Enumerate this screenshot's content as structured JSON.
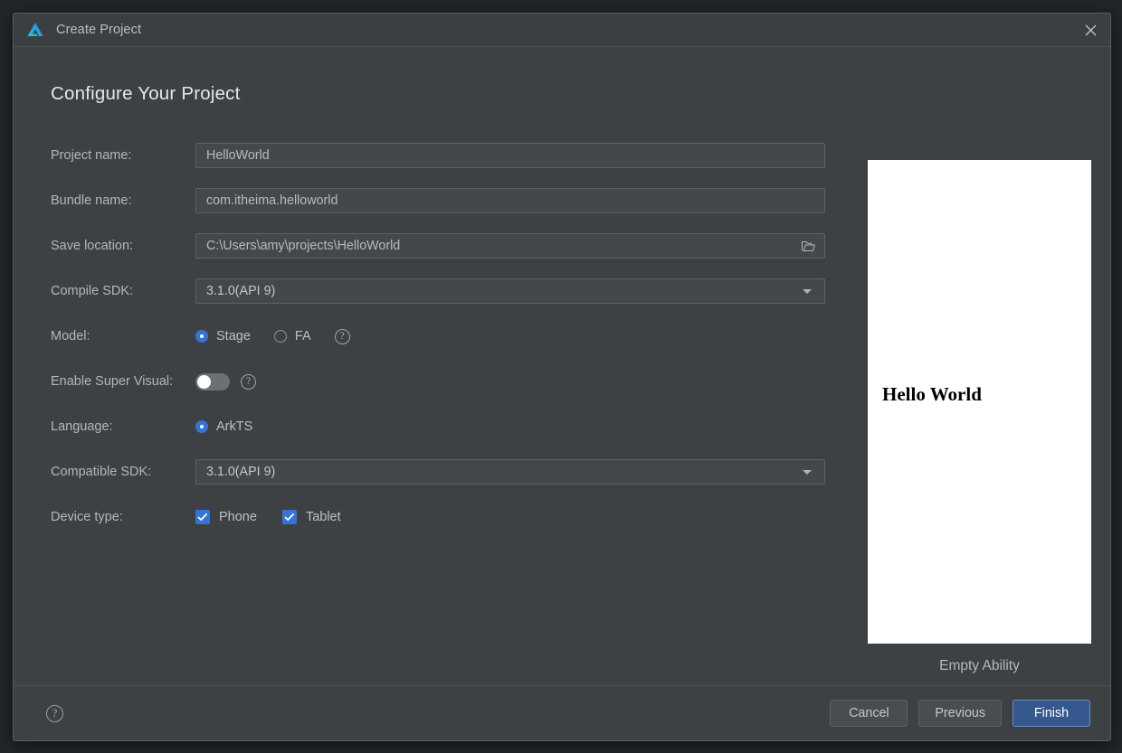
{
  "window": {
    "title": "Create Project",
    "logo_icon": "devtools-logo-icon",
    "close_icon": "close-icon"
  },
  "main": {
    "heading": "Configure Your Project",
    "fields": {
      "project_name": {
        "label": "Project name:",
        "value": "HelloWorld"
      },
      "bundle_name": {
        "label": "Bundle name:",
        "value": "com.itheima.helloworld"
      },
      "save_location": {
        "label": "Save location:",
        "value": "C:\\Users\\amy\\projects\\HelloWorld",
        "icon": "folder-open-icon"
      },
      "compile_sdk": {
        "label": "Compile SDK:",
        "value": "3.1.0(API 9)",
        "icon": "chevron-down-icon"
      },
      "model": {
        "label": "Model:",
        "options": [
          {
            "label": "Stage",
            "selected": true
          },
          {
            "label": "FA",
            "selected": false
          }
        ],
        "help_icon": "help-icon",
        "help_glyph": "?"
      },
      "enable_super_visual": {
        "label": "Enable Super Visual:",
        "state": "off",
        "help_icon": "help-icon",
        "help_glyph": "?"
      },
      "language": {
        "label": "Language:",
        "options": [
          {
            "label": "ArkTS",
            "selected": true
          }
        ]
      },
      "compatible_sdk": {
        "label": "Compatible SDK:",
        "value": "3.1.0(API 9)",
        "icon": "chevron-down-icon"
      },
      "device_type": {
        "label": "Device type:",
        "options": [
          {
            "label": "Phone",
            "checked": true
          },
          {
            "label": "Tablet",
            "checked": true
          }
        ]
      }
    }
  },
  "preview": {
    "screen_text": "Hello World",
    "caption": "Empty Ability"
  },
  "footer": {
    "help_glyph": "?",
    "help_icon": "help-icon",
    "cancel_label": "Cancel",
    "previous_label": "Previous",
    "finish_label": "Finish"
  },
  "colors": {
    "accent": "#3574d6",
    "primary_button": "#35588f",
    "dialog_bg": "#3e4143",
    "titlebar_bg": "#3c3f41",
    "text": "#b4b7ba"
  }
}
